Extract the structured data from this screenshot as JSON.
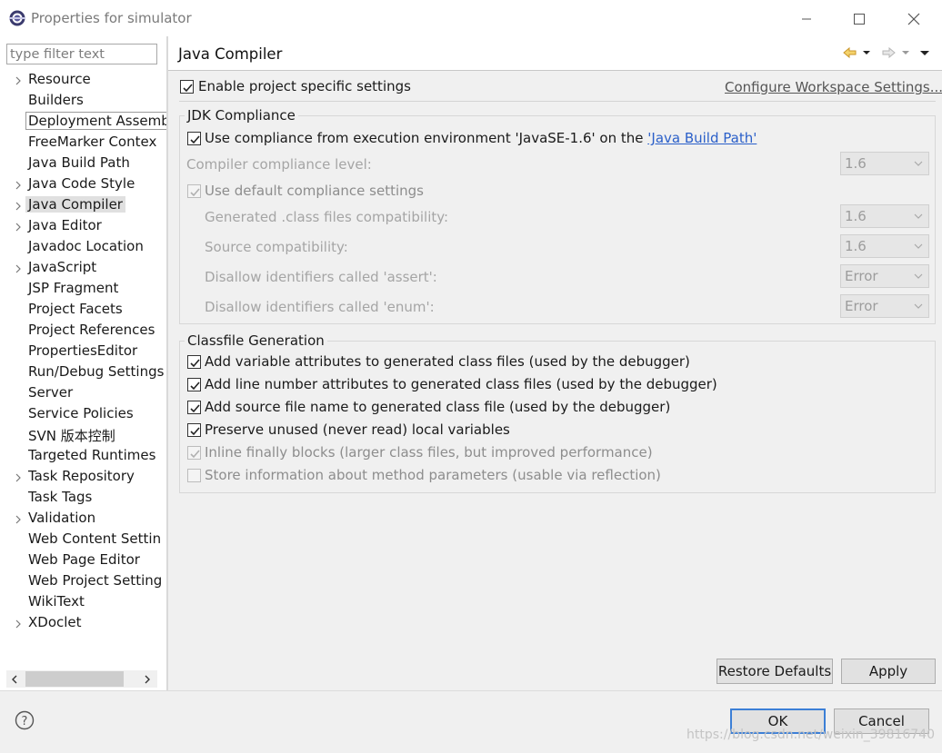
{
  "window": {
    "title": "Properties for simulator",
    "colors": {
      "selected_row": "#e0e0e0",
      "link": "#2a5fc9",
      "panel_bg": "#f0f0f0"
    }
  },
  "sidebar": {
    "filter_placeholder": "type filter text",
    "items": [
      {
        "label": "Resource",
        "expandable": true
      },
      {
        "label": "Builders",
        "expandable": false
      },
      {
        "label": "Deployment Assembly",
        "expandable": false,
        "hover": true
      },
      {
        "label": "FreeMarker Contex",
        "expandable": false
      },
      {
        "label": "Java Build Path",
        "expandable": false
      },
      {
        "label": "Java Code Style",
        "expandable": true
      },
      {
        "label": "Java Compiler",
        "expandable": true,
        "selected": true
      },
      {
        "label": "Java Editor",
        "expandable": true
      },
      {
        "label": "Javadoc Location",
        "expandable": false
      },
      {
        "label": "JavaScript",
        "expandable": true
      },
      {
        "label": "JSP Fragment",
        "expandable": false
      },
      {
        "label": "Project Facets",
        "expandable": false
      },
      {
        "label": "Project References",
        "expandable": false
      },
      {
        "label": "PropertiesEditor",
        "expandable": false
      },
      {
        "label": "Run/Debug Settings",
        "expandable": false
      },
      {
        "label": "Server",
        "expandable": false
      },
      {
        "label": "Service Policies",
        "expandable": false
      },
      {
        "label": "SVN 版本控制",
        "expandable": false
      },
      {
        "label": "Targeted Runtimes",
        "expandable": false
      },
      {
        "label": "Task Repository",
        "expandable": true
      },
      {
        "label": "Task Tags",
        "expandable": false
      },
      {
        "label": "Validation",
        "expandable": true
      },
      {
        "label": "Web Content Settin",
        "expandable": false
      },
      {
        "label": "Web Page Editor",
        "expandable": false
      },
      {
        "label": "Web Project Setting",
        "expandable": false
      },
      {
        "label": "WikiText",
        "expandable": false
      },
      {
        "label": "XDoclet",
        "expandable": true
      }
    ]
  },
  "page": {
    "title": "Java Compiler",
    "enable_label": "Enable project specific settings",
    "configure_link": "Configure Workspace Settings...",
    "jdk": {
      "group_title": "JDK Compliance",
      "use_compliance_prefix": "Use compliance from execution environment 'JavaSE-1.6' on the ",
      "use_compliance_link": "'Java Build Path'",
      "compliance_level_label": "Compiler compliance level:",
      "compliance_level_value": "1.6",
      "use_default_label": "Use default compliance settings",
      "class_compat_label": "Generated .class files compatibility:",
      "class_compat_value": "1.6",
      "source_compat_label": "Source compatibility:",
      "source_compat_value": "1.6",
      "assert_label": "Disallow identifiers called 'assert':",
      "assert_value": "Error",
      "enum_label": "Disallow identifiers called 'enum':",
      "enum_value": "Error"
    },
    "classfile": {
      "group_title": "Classfile Generation",
      "options": [
        {
          "label": "Add variable attributes to generated class files (used by the debugger)",
          "checked": true,
          "enabled": true
        },
        {
          "label": "Add line number attributes to generated class files (used by the debugger)",
          "checked": true,
          "enabled": true
        },
        {
          "label": "Add source file name to generated class file (used by the debugger)",
          "checked": true,
          "enabled": true
        },
        {
          "label": "Preserve unused (never read) local variables",
          "checked": true,
          "enabled": true
        },
        {
          "label": "Inline finally blocks (larger class files, but improved performance)",
          "checked": true,
          "enabled": false
        },
        {
          "label": "Store information about method parameters (usable via reflection)",
          "checked": false,
          "enabled": false
        }
      ]
    },
    "restore_defaults": "Restore Defaults",
    "apply": "Apply"
  },
  "footer": {
    "ok": "OK",
    "cancel": "Cancel",
    "watermark": "https://blog.csdn.net/weixin_39816740"
  }
}
